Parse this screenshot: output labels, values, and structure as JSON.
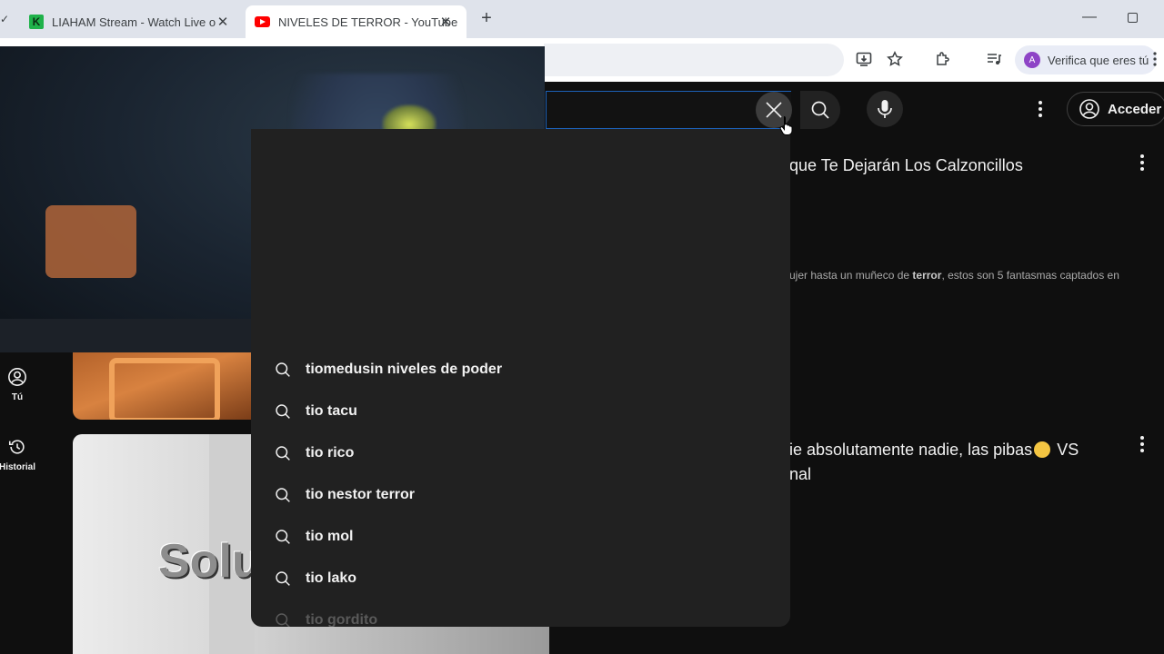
{
  "browser": {
    "tabs": [
      {
        "title": "LIAHAM Stream - Watch Live o",
        "favicon": "K",
        "active": false
      },
      {
        "title": "NIVELES DE TERROR - YouTube",
        "favicon": "youtube-icon",
        "active": true
      }
    ],
    "verify_label": "Verifica que eres tú",
    "profile_initial": "A"
  },
  "youtube": {
    "login_label": "Acceder",
    "guide": [
      {
        "label": "Tú",
        "icon": "account-circle-icon"
      },
      {
        "label": "Historial",
        "icon": "history-icon"
      }
    ],
    "results": [
      {
        "title": "que Te Dejarán Los Calzoncillos",
        "desc_pre": "ujer hasta un muñeco de ",
        "desc_bold": "terror",
        "desc_post": ", estos son 5 fantasmas captados en"
      },
      {
        "title_line1": "ie absolutamente nadie, las pibas",
        "title_line1_end": " VS",
        "title_line2": "nal"
      }
    ],
    "thumb_overlay_text": "Soluci"
  },
  "suggestions": [
    "tiomedusin niveles de poder",
    "tio tacu",
    "tio rico",
    "tio nestor terror",
    "tio mol",
    "tio lako",
    "tio gordito"
  ],
  "colors": {
    "search_border": "#1c62b9",
    "yt_bg": "#0f0f0f",
    "dropdown_bg": "#212121"
  }
}
